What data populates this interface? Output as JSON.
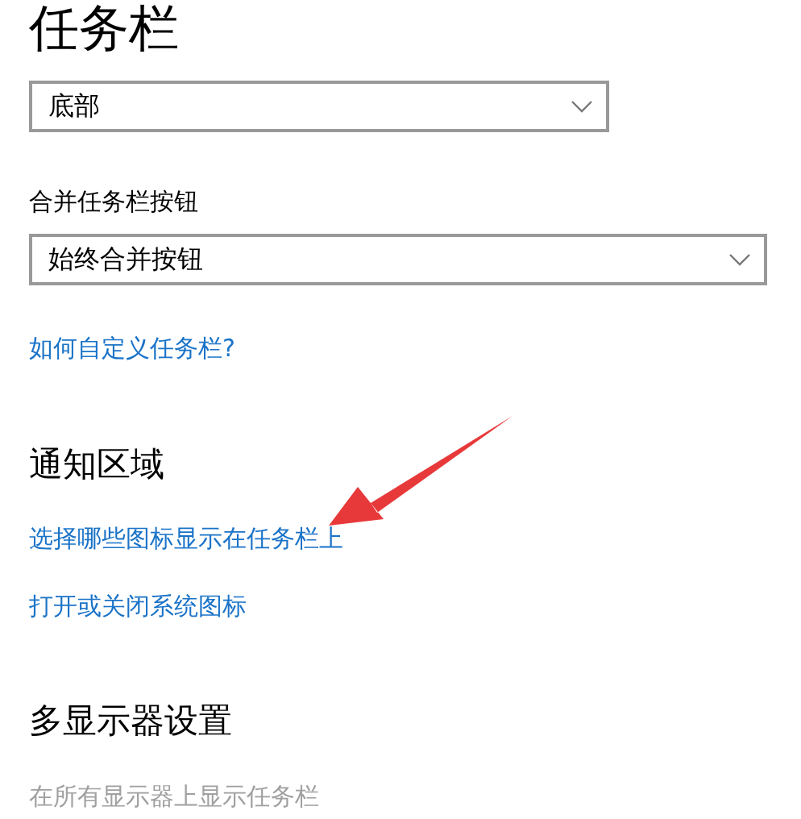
{
  "title": "任务栏",
  "position_dropdown": {
    "value": "底部"
  },
  "combine_buttons": {
    "label": "合并任务栏按钮",
    "value": "始终合并按钮"
  },
  "help_link": "如何自定义任务栏?",
  "notification_area": {
    "heading": "通知区域",
    "links": [
      "选择哪些图标显示在任务栏上",
      "打开或关闭系统图标"
    ]
  },
  "multiple_displays": {
    "heading": "多显示器设置",
    "setting": {
      "label": "在所有显示器上显示任务栏",
      "disabled": true
    }
  }
}
